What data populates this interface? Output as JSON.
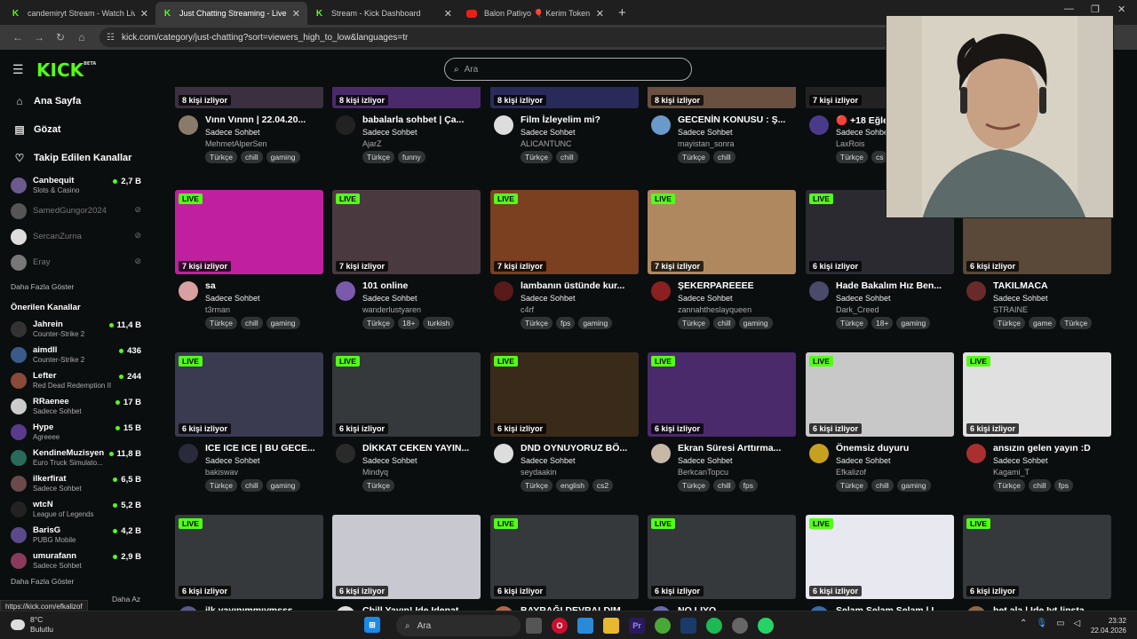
{
  "browser": {
    "tabs": [
      {
        "title": "candemiryt Stream - Watch Live",
        "icon": "kick-icon"
      },
      {
        "title": "Just Chatting Streaming - Live St",
        "icon": "kick-icon"
      },
      {
        "title": "Stream - Kick Dashboard",
        "icon": "kick-icon"
      },
      {
        "title": "Balon Patlıyo 🎈 Kerim Token #",
        "icon": "youtube-icon"
      }
    ],
    "url": "kick.com/category/just-chatting?sort=viewers_high_to_low&languages=tr"
  },
  "header": {
    "logo": "KICK",
    "logo_sup": "BETA",
    "search_placeholder": "Ara"
  },
  "sidebar": {
    "nav": [
      {
        "label": "Ana Sayfa",
        "icon": "home-icon"
      },
      {
        "label": "Gözat",
        "icon": "browse-icon"
      },
      {
        "label": "Takip Edilen Kanallar",
        "icon": "heart-icon"
      }
    ],
    "followed": [
      {
        "name": "Canbequit",
        "category": "Slots & Casino",
        "viewers": "2,7 B",
        "live": true,
        "color": "#6a5b8c"
      },
      {
        "name": "SamedGungor2024",
        "category": "",
        "viewers": "",
        "live": false,
        "color": "#555"
      },
      {
        "name": "SercanZurna",
        "category": "",
        "viewers": "",
        "live": false,
        "color": "#ddd"
      },
      {
        "name": "Eray",
        "category": "",
        "viewers": "",
        "live": false,
        "color": "#777"
      }
    ],
    "show_more": "Daha Fazla Göster",
    "recommended_title": "Önerilen Kanallar",
    "recommended": [
      {
        "name": "Jahrein",
        "category": "Counter-Strike 2",
        "viewers": "11,4 B",
        "color": "#333"
      },
      {
        "name": "aimdll",
        "category": "Counter-Strike 2",
        "viewers": "436",
        "color": "#3a5a8a"
      },
      {
        "name": "Lefter",
        "category": "Red Dead Redemption II",
        "viewers": "244",
        "color": "#8a4a3a"
      },
      {
        "name": "RRaenee",
        "category": "Sadece Sohbet",
        "viewers": "17 B",
        "color": "#ccc"
      },
      {
        "name": "Hype",
        "category": "Agreeee",
        "viewers": "15 B",
        "color": "#5a3a8a"
      },
      {
        "name": "KendineMuzisyen",
        "category": "Euro Truck Simulato...",
        "viewers": "11,8 B",
        "color": "#2a6a5a"
      },
      {
        "name": "ilkerfirat",
        "category": "Sadece Sohbet",
        "viewers": "6,5 B",
        "color": "#6a4a4a"
      },
      {
        "name": "wtcN",
        "category": "League of Legends",
        "viewers": "5,2 B",
        "color": "#222"
      },
      {
        "name": "BarisG",
        "category": "PUBG Mobile",
        "viewers": "4,2 B",
        "color": "#5a4a8a"
      },
      {
        "name": "umurafann",
        "category": "Sadece Sohbet",
        "viewers": "2,9 B",
        "color": "#8a3a5a"
      }
    ],
    "show_more_bottom": "Daha Fazla Göster",
    "show_less": "Daha Az"
  },
  "live_label": "LIVE",
  "streams": [
    {
      "viewers": "8 kişi izliyor",
      "title": "Vınn Vınnn | 22.04.20...",
      "category": "Sadece Sohbet",
      "streamer": "MehmetAlperSen",
      "tags": [
        "Türkçe",
        "chill",
        "gaming"
      ],
      "live": false,
      "thumb": "#3a3040",
      "avatar": "#8a7a6a"
    },
    {
      "viewers": "8 kişi izliyor",
      "title": "babalarla sohbet | Ça...",
      "category": "Sadece Sohbet",
      "streamer": "AjarZ",
      "tags": [
        "Türkçe",
        "funny"
      ],
      "live": false,
      "thumb": "#4a2a6a",
      "avatar": "#222"
    },
    {
      "viewers": "8 kişi izliyor",
      "title": "Film İzleyelim mi?",
      "category": "Sadece Sohbet",
      "streamer": "ALICANTUNC",
      "tags": [
        "Türkçe",
        "chill"
      ],
      "live": false,
      "thumb": "#2a2a5a",
      "avatar": "#ddd"
    },
    {
      "viewers": "8 kişi izliyor",
      "title": "GECENİN KONUSU : Ş...",
      "category": "Sadece Sohbet",
      "streamer": "mayistan_sonra",
      "tags": [
        "Türkçe",
        "chill"
      ],
      "live": false,
      "thumb": "#6a5040",
      "avatar": "#6a9aca"
    },
    {
      "viewers": "7 kişi izliyor",
      "title": "🔴 +18 Eğlen...",
      "category": "Sadece Sohbet",
      "streamer": "LaxRois",
      "tags": [
        "Türkçe",
        "cs"
      ],
      "live": false,
      "thumb": "#222",
      "avatar": "#4a3a8a"
    },
    {
      "viewers": "7 kişi izliyor",
      "title": "sa",
      "category": "Sadece Sohbet",
      "streamer": "t3rman",
      "tags": [
        "Türkçe",
        "chill",
        "gaming"
      ],
      "live": true,
      "thumb": "#c020a0",
      "avatar": "#d8a0a0"
    },
    {
      "viewers": "7 kişi izliyor",
      "title": "101 online",
      "category": "Sadece Sohbet",
      "streamer": "wanderlustyaren",
      "tags": [
        "Türkçe",
        "18+",
        "turkish"
      ],
      "live": true,
      "thumb": "#4a3a40",
      "avatar": "#7a5aaa"
    },
    {
      "viewers": "7 kişi izliyor",
      "title": "lambanın üstünde kur...",
      "category": "Sadece Sohbet",
      "streamer": "c4rf",
      "tags": [
        "Türkçe",
        "fps",
        "gaming"
      ],
      "live": true,
      "thumb": "#7a4020",
      "avatar": "#5a1a1a"
    },
    {
      "viewers": "7 kişi izliyor",
      "title": "ŞEKERPAREEEE",
      "category": "Sadece Sohbet",
      "streamer": "zannahtheslayqueen",
      "tags": [
        "Türkçe",
        "chill",
        "gaming"
      ],
      "live": true,
      "thumb": "#b08860",
      "avatar": "#8a2020"
    },
    {
      "viewers": "6 kişi izliyor",
      "title": "Hade Bakalım Hız Ben...",
      "category": "Sadece Sohbet",
      "streamer": "Dark_Creed",
      "tags": [
        "Türkçe",
        "18+",
        "gaming"
      ],
      "live": true,
      "thumb": "#2a2a30",
      "avatar": "#4a4a6a"
    },
    {
      "viewers": "6 kişi izliyor",
      "title": "TAKILMACA",
      "category": "Sadece Sohbet",
      "streamer": "STRAINE",
      "tags": [
        "Türkçe",
        "game",
        "Türkçe"
      ],
      "live": false,
      "thumb": "#5a4838",
      "avatar": "#6a2a2a"
    },
    {
      "viewers": "6 kişi izliyor",
      "title": "ICE ICE ICE | BU GECE...",
      "category": "Sadece Sohbet",
      "streamer": "bakiswav",
      "tags": [
        "Türkçe",
        "chill",
        "gaming"
      ],
      "live": true,
      "thumb": "#3a3a50",
      "avatar": "#2a2a3a"
    },
    {
      "viewers": "6 kişi izliyor",
      "title": "DİKKAT CEKEN YAYIN...",
      "category": "Sadece Sohbet",
      "streamer": "Mindyq",
      "tags": [
        "Türkçe"
      ],
      "live": true,
      "thumb": "#35393b",
      "avatar": "#2a2a2a"
    },
    {
      "viewers": "6 kişi izliyor",
      "title": "DND OYNUYORUZ BÖ...",
      "category": "Sadece Sohbet",
      "streamer": "seydaakin",
      "tags": [
        "Türkçe",
        "english",
        "cs2"
      ],
      "live": true,
      "thumb": "#3a2a1a",
      "avatar": "#ddd"
    },
    {
      "viewers": "6 kişi izliyor",
      "title": "Ekran Süresi Arttırma...",
      "category": "Sadece Sohbet",
      "streamer": "BerkcanTopcu",
      "tags": [
        "Türkçe",
        "chill",
        "fps"
      ],
      "live": true,
      "thumb": "#4a2a6a",
      "avatar": "#c8b8a8"
    },
    {
      "viewers": "6 kişi izliyor",
      "title": "Önemsiz duyuru",
      "category": "Sadece Sohbet",
      "streamer": "Efkalizof",
      "tags": [
        "Türkçe",
        "chill",
        "gaming"
      ],
      "live": true,
      "thumb": "#c8c8c8",
      "avatar": "#c8a020"
    },
    {
      "viewers": "6 kişi izliyor",
      "title": "ansızın gelen yayın :D",
      "category": "Sadece Sohbet",
      "streamer": "Kagami_T",
      "tags": [
        "Türkçe",
        "chill",
        "fps"
      ],
      "live": true,
      "thumb": "#e0e0e0",
      "avatar": "#aa3030"
    },
    {
      "viewers": "6 kişi izliyor",
      "title": "ilk yayınımmıymsss...",
      "category": "",
      "streamer": "",
      "tags": [],
      "live": true,
      "thumb": "#35393b",
      "avatar": "#5a5a8a"
    },
    {
      "viewers": "6 kişi izliyor",
      "title": "Chill Yayın! Ide Idenat",
      "category": "",
      "streamer": "",
      "tags": [],
      "live": false,
      "thumb": "#c8c8d0",
      "avatar": "#ddd"
    },
    {
      "viewers": "6 kişi izliyor",
      "title": "BAYRAĞI DEVRALDIM",
      "category": "",
      "streamer": "",
      "tags": [],
      "live": true,
      "thumb": "#35393b",
      "avatar": "#aa6a4a"
    },
    {
      "viewers": "6 kişi izliyor",
      "title": "NO LIYO",
      "category": "",
      "streamer": "",
      "tags": [],
      "live": true,
      "thumb": "#35393b",
      "avatar": "#6a6aaa"
    },
    {
      "viewers": "6 kişi izliyor",
      "title": "Selam Selam Selam | L...",
      "category": "",
      "streamer": "",
      "tags": [],
      "live": true,
      "thumb": "#e8e8f0",
      "avatar": "#3a6aaa"
    },
    {
      "viewers": "6 kişi izliyor",
      "title": "bet ala | Ide Iyt linsta",
      "category": "",
      "streamer": "",
      "tags": [],
      "live": true,
      "thumb": "#35393b",
      "avatar": "#8a6a4a"
    }
  ],
  "status_url": "https://kick.com/efkalizof",
  "taskbar": {
    "weather_temp": "8°C",
    "weather_desc": "Bulutlu",
    "search": "Ara",
    "time": "23:32",
    "date": "22.04.2026"
  },
  "colors": {
    "accent": "#53fc18",
    "background": "#0b0e0f",
    "tag": "#2f3334"
  }
}
